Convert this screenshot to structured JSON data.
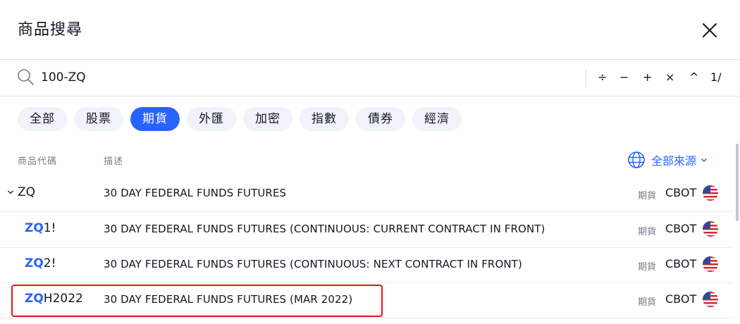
{
  "dialog": {
    "title": "商品搜尋",
    "close_icon": "close-icon"
  },
  "search": {
    "value": "100-ZQ",
    "tools": {
      "divide": "÷",
      "minus": "−",
      "plus": "+",
      "multiply": "×",
      "power": "^",
      "reciprocal": "1/"
    }
  },
  "filters": [
    {
      "label": "全部",
      "active": false
    },
    {
      "label": "股票",
      "active": false
    },
    {
      "label": "期貨",
      "active": true
    },
    {
      "label": "外匯",
      "active": false
    },
    {
      "label": "加密",
      "active": false
    },
    {
      "label": "指數",
      "active": false
    },
    {
      "label": "債券",
      "active": false
    },
    {
      "label": "經濟",
      "active": false
    }
  ],
  "columns": {
    "symbol": "商品代碼",
    "description": "描述",
    "sources": "全部來源"
  },
  "group": {
    "symbol": "ZQ",
    "description": "30 DAY FEDERAL FUNDS FUTURES",
    "type": "期貨",
    "exchange": "CBOT"
  },
  "rows": [
    {
      "sym_highlight": "ZQ",
      "sym_rest": "1!",
      "description": "30 DAY FEDERAL FUNDS FUTURES (CONTINUOUS: CURRENT CONTRACT IN FRONT)",
      "type": "期貨",
      "exchange": "CBOT"
    },
    {
      "sym_highlight": "ZQ",
      "sym_rest": "2!",
      "description": "30 DAY FEDERAL FUNDS FUTURES (CONTINUOUS: NEXT CONTRACT IN FRONT)",
      "type": "期貨",
      "exchange": "CBOT"
    },
    {
      "sym_highlight": "ZQ",
      "sym_rest": "H2022",
      "description": "30 DAY FEDERAL FUNDS FUTURES (MAR 2022)",
      "type": "期貨",
      "exchange": "CBOT"
    }
  ],
  "colors": {
    "accent": "#2962ff",
    "highlight_border": "#e5141c",
    "muted": "#787b86"
  }
}
